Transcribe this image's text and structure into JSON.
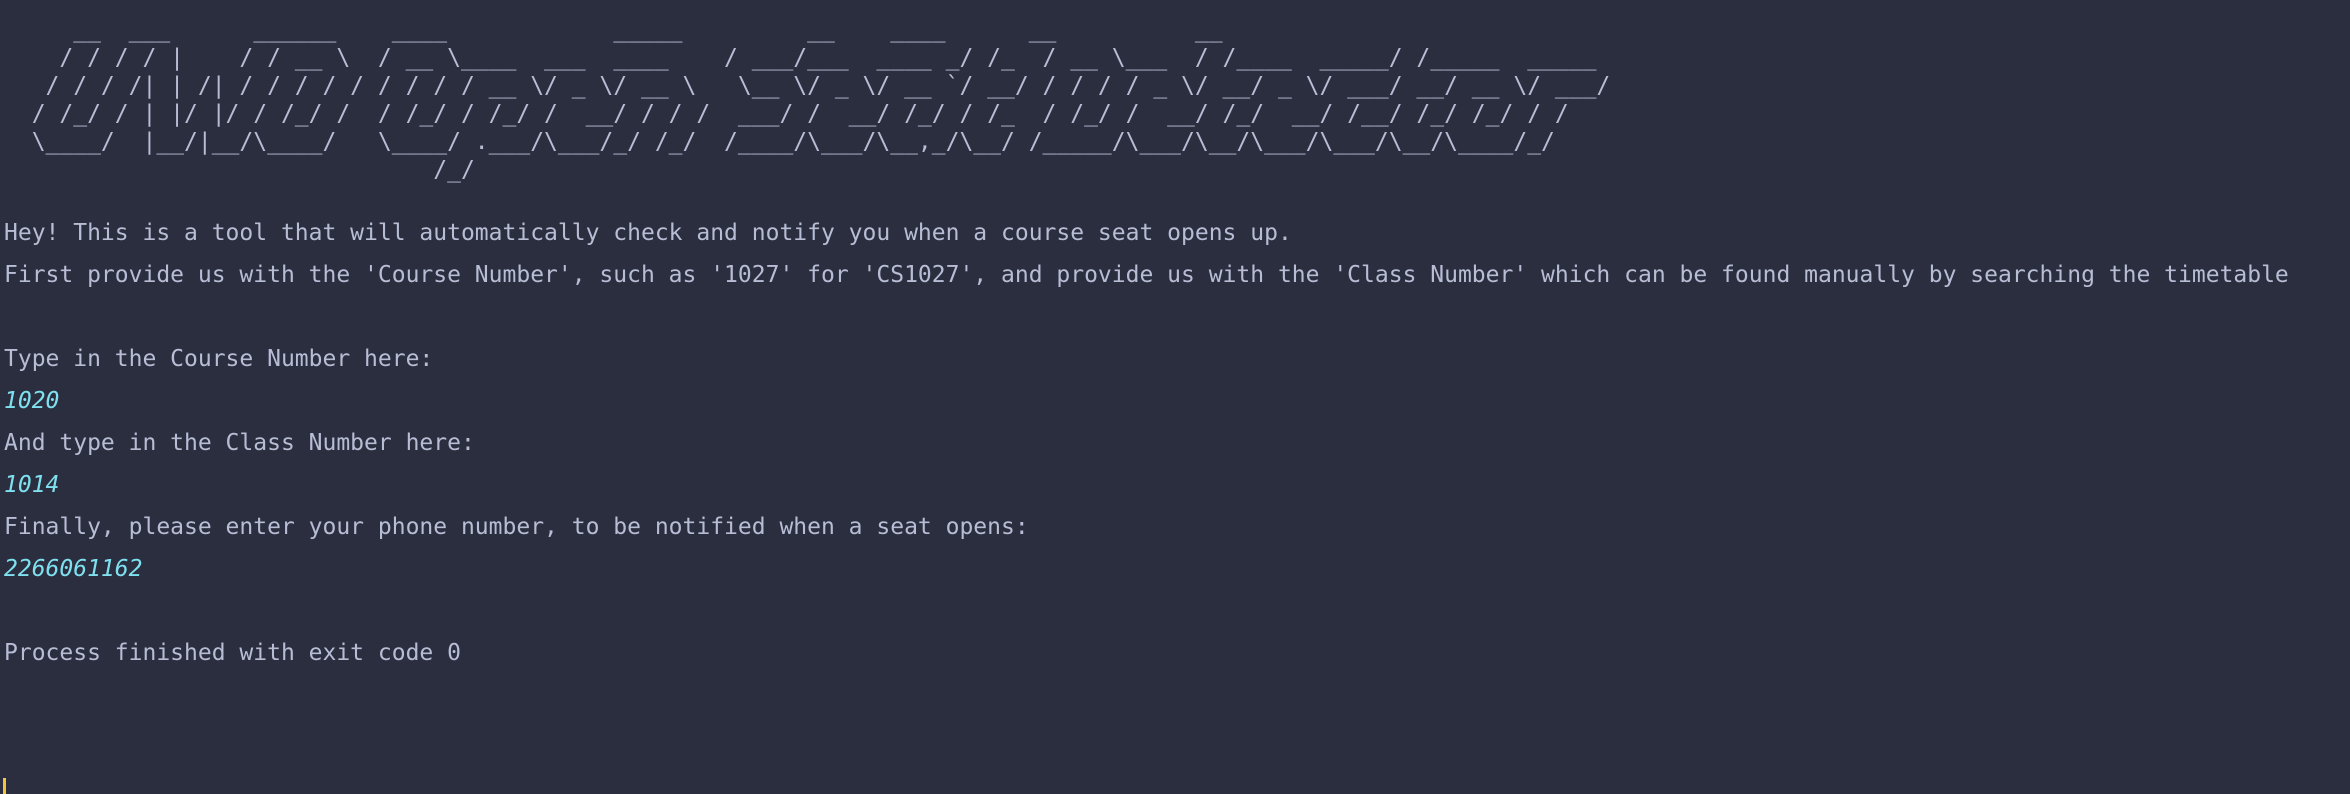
{
  "banner": {
    "ascii_art": "     __  ___      ______    ____            _____         __    ____      __          __\n    / / / / |    / / __ \\  / __ \\____  ___  ____    / ___/___  ____ _/ /_  / __ \\___  / /____  _____/ /_____  _____\n   / / / /| | /| / / / / / / / / / __ \\/ _ \\/ __ \\   \\__ \\/ _ \\/ __ `/ __/ / / / / _ \\/ __/ _ \\/ ___/ __/ __ \\/ ___/\n  / /_/ / | |/ |/ / /_/ /  / /_/ / /_/ /  __/ / / /  ___/ /  __/ /_/ / /_  / /_/ /  __/ /_/  __/ /__/ /_/ /_/ / /\n  \\____/  |__/|__/\\____/   \\____/ .___/\\___/_/ /_/  /____/\\___/\\__,_/\\__/ /_____/\\___/\\__/\\___/\\___/\\__/\\____/_/\n                               /_/"
  },
  "output": {
    "intro_line_1": "Hey! This is a tool that will automatically check and notify you when a course seat opens up.",
    "intro_line_2": "First provide us with the 'Course Number', such as '1027' for 'CS1027', and provide us with the 'Class Number' which can be found manually by searching the timetable",
    "course_prompt": "Type in the Course Number here:",
    "course_value": "1020",
    "class_prompt": "And type in the Class Number here:",
    "class_value": "1014",
    "phone_prompt": "Finally, please enter your phone number, to be notified when a seat opens:",
    "phone_value": "2266061162",
    "exit_message": "Process finished with exit code 0"
  },
  "colors": {
    "background": "#2b2e3e",
    "text": "#b8bdd6",
    "input": "#7fe0ef",
    "cursor": "#f3c53a"
  }
}
